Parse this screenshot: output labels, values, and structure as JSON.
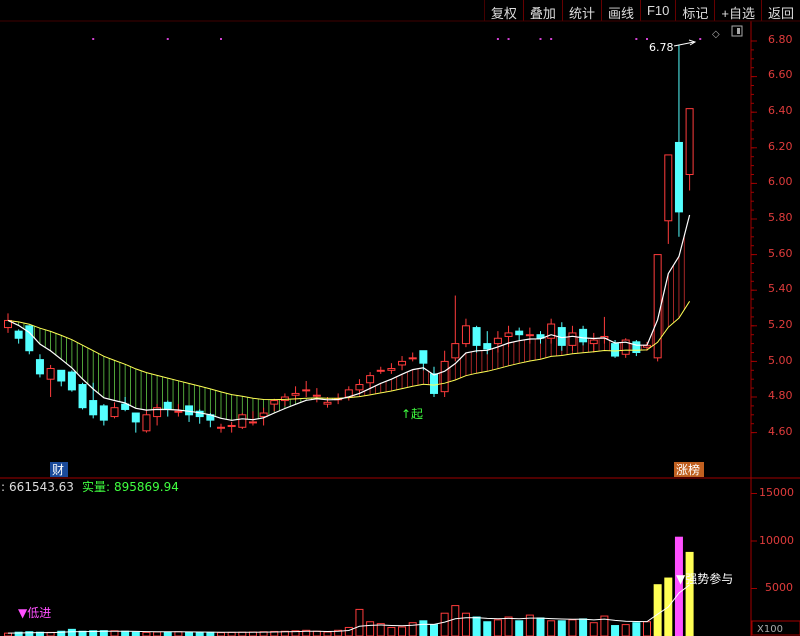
{
  "toolbar": {
    "buttons": [
      "复权",
      "叠加",
      "统计",
      "画线",
      "F10",
      "标记",
      "+自选",
      "返回"
    ]
  },
  "price_axis": {
    "ticks": [
      "6.80",
      "6.60",
      "6.40",
      "6.20",
      "6.00",
      "5.80",
      "5.60",
      "5.40",
      "5.20",
      "5.00",
      "4.80",
      "4.60"
    ]
  },
  "volume_axis": {
    "ticks": [
      "15000",
      "10000",
      "5000"
    ],
    "unit": "X100"
  },
  "markers": {
    "high_label": "6.78",
    "start_label": "↑起",
    "finance_tag": "财",
    "limit_tag": "涨榜",
    "buy_label": "▼低进",
    "signal_label": "▼强势参与"
  },
  "volume_info": {
    "prefix": ":",
    "value1": "661543.63",
    "real_label": "实量:",
    "value2": "895869.94"
  },
  "colors": {
    "up": "#ff3c3c",
    "down": "#54ffff",
    "ma_white": "#ffffff",
    "ma_yellow": "#ffff55",
    "band_green": "#7dff5a",
    "band_red": "#ff3c3c",
    "axis": "#a00000"
  },
  "chart_data": {
    "type": "candlestick",
    "price_ylim": [
      4.52,
      6.86
    ],
    "volume_ylim": [
      0,
      16700
    ],
    "candles": [
      [
        5.19,
        5.23,
        5.16,
        5.27
      ],
      [
        5.17,
        5.13,
        5.1,
        5.18
      ],
      [
        5.2,
        5.06,
        5.04,
        5.2
      ],
      [
        5.01,
        4.93,
        4.91,
        5.04
      ],
      [
        4.9,
        4.96,
        4.8,
        4.98
      ],
      [
        4.95,
        4.89,
        4.86,
        4.95
      ],
      [
        4.94,
        4.84,
        4.83,
        4.95
      ],
      [
        4.87,
        4.74,
        4.73,
        4.88
      ],
      [
        4.78,
        4.7,
        4.68,
        4.88
      ],
      [
        4.75,
        4.67,
        4.64,
        4.76
      ],
      [
        4.69,
        4.74,
        4.68,
        4.77
      ],
      [
        4.76,
        4.73,
        4.72,
        4.8
      ],
      [
        4.71,
        4.66,
        4.6,
        4.71
      ],
      [
        4.61,
        4.7,
        4.6,
        4.73
      ],
      [
        4.69,
        4.74,
        4.64,
        4.76
      ],
      [
        4.77,
        4.73,
        4.69,
        4.78
      ],
      [
        4.72,
        4.72,
        4.69,
        4.76
      ],
      [
        4.75,
        4.7,
        4.66,
        4.75
      ],
      [
        4.72,
        4.69,
        4.65,
        4.73
      ],
      [
        4.7,
        4.67,
        4.63,
        4.71
      ],
      [
        4.63,
        4.63,
        4.6,
        4.65
      ],
      [
        4.64,
        4.64,
        4.6,
        4.66
      ],
      [
        4.63,
        4.7,
        4.62,
        4.71
      ],
      [
        4.66,
        4.66,
        4.64,
        4.72
      ],
      [
        4.69,
        4.71,
        4.64,
        4.74
      ],
      [
        4.76,
        4.78,
        4.72,
        4.79
      ],
      [
        4.78,
        4.8,
        4.75,
        4.82
      ],
      [
        4.81,
        4.82,
        4.78,
        4.86
      ],
      [
        4.84,
        4.84,
        4.8,
        4.89
      ],
      [
        4.81,
        4.81,
        4.77,
        4.85
      ],
      [
        4.76,
        4.77,
        4.74,
        4.8
      ],
      [
        4.79,
        4.79,
        4.76,
        4.82
      ],
      [
        4.8,
        4.84,
        4.78,
        4.86
      ],
      [
        4.84,
        4.87,
        4.82,
        4.9
      ],
      [
        4.88,
        4.92,
        4.85,
        4.94
      ],
      [
        4.95,
        4.95,
        4.93,
        4.97
      ],
      [
        4.95,
        4.96,
        4.93,
        4.99
      ],
      [
        4.98,
        5.0,
        4.95,
        5.03
      ],
      [
        5.02,
        5.02,
        5.0,
        5.05
      ],
      [
        5.06,
        4.99,
        4.95,
        5.06
      ],
      [
        4.93,
        4.82,
        4.8,
        4.97
      ],
      [
        4.83,
        5.0,
        4.8,
        5.06
      ],
      [
        5.02,
        5.1,
        5.0,
        5.37
      ],
      [
        5.1,
        5.2,
        5.08,
        5.24
      ],
      [
        5.19,
        5.09,
        5.05,
        5.2
      ],
      [
        5.1,
        5.07,
        5.04,
        5.17
      ],
      [
        5.1,
        5.13,
        5.05,
        5.17
      ],
      [
        5.14,
        5.16,
        5.08,
        5.2
      ],
      [
        5.17,
        5.15,
        5.12,
        5.19
      ],
      [
        5.15,
        5.15,
        5.1,
        5.19
      ],
      [
        5.15,
        5.13,
        5.1,
        5.17
      ],
      [
        5.13,
        5.21,
        5.1,
        5.24
      ],
      [
        5.19,
        5.09,
        5.06,
        5.22
      ],
      [
        5.09,
        5.16,
        5.06,
        5.2
      ],
      [
        5.18,
        5.11,
        5.09,
        5.2
      ],
      [
        5.1,
        5.12,
        5.05,
        5.16
      ],
      [
        5.13,
        5.14,
        5.1,
        5.25
      ],
      [
        5.1,
        5.03,
        5.02,
        5.12
      ],
      [
        5.04,
        5.12,
        5.02,
        5.13
      ],
      [
        5.11,
        5.05,
        5.03,
        5.12
      ],
      [
        5.08,
        5.09,
        5.06,
        5.11
      ],
      [
        5.02,
        5.6,
        5.0,
        5.6
      ],
      [
        5.79,
        6.16,
        5.66,
        6.16
      ],
      [
        6.23,
        5.84,
        5.7,
        6.78
      ],
      [
        6.05,
        6.42,
        5.96,
        6.42
      ]
    ],
    "volumes": [
      300,
      400,
      450,
      400,
      380,
      500,
      700,
      500,
      550,
      560,
      550,
      500,
      400,
      380,
      420,
      400,
      450,
      380,
      380,
      380,
      350,
      380,
      400,
      420,
      450,
      480,
      500,
      550,
      600,
      500,
      420,
      600,
      900,
      2800,
      1500,
      1300,
      900,
      950,
      1400,
      1600,
      1200,
      2400,
      3200,
      2400,
      2000,
      1500,
      1700,
      2000,
      1600,
      2200,
      1900,
      1600,
      1600,
      1700,
      1800,
      1400,
      2100,
      1100,
      1200,
      1400,
      1500,
      5400,
      6100,
      10400,
      8800
    ]
  }
}
